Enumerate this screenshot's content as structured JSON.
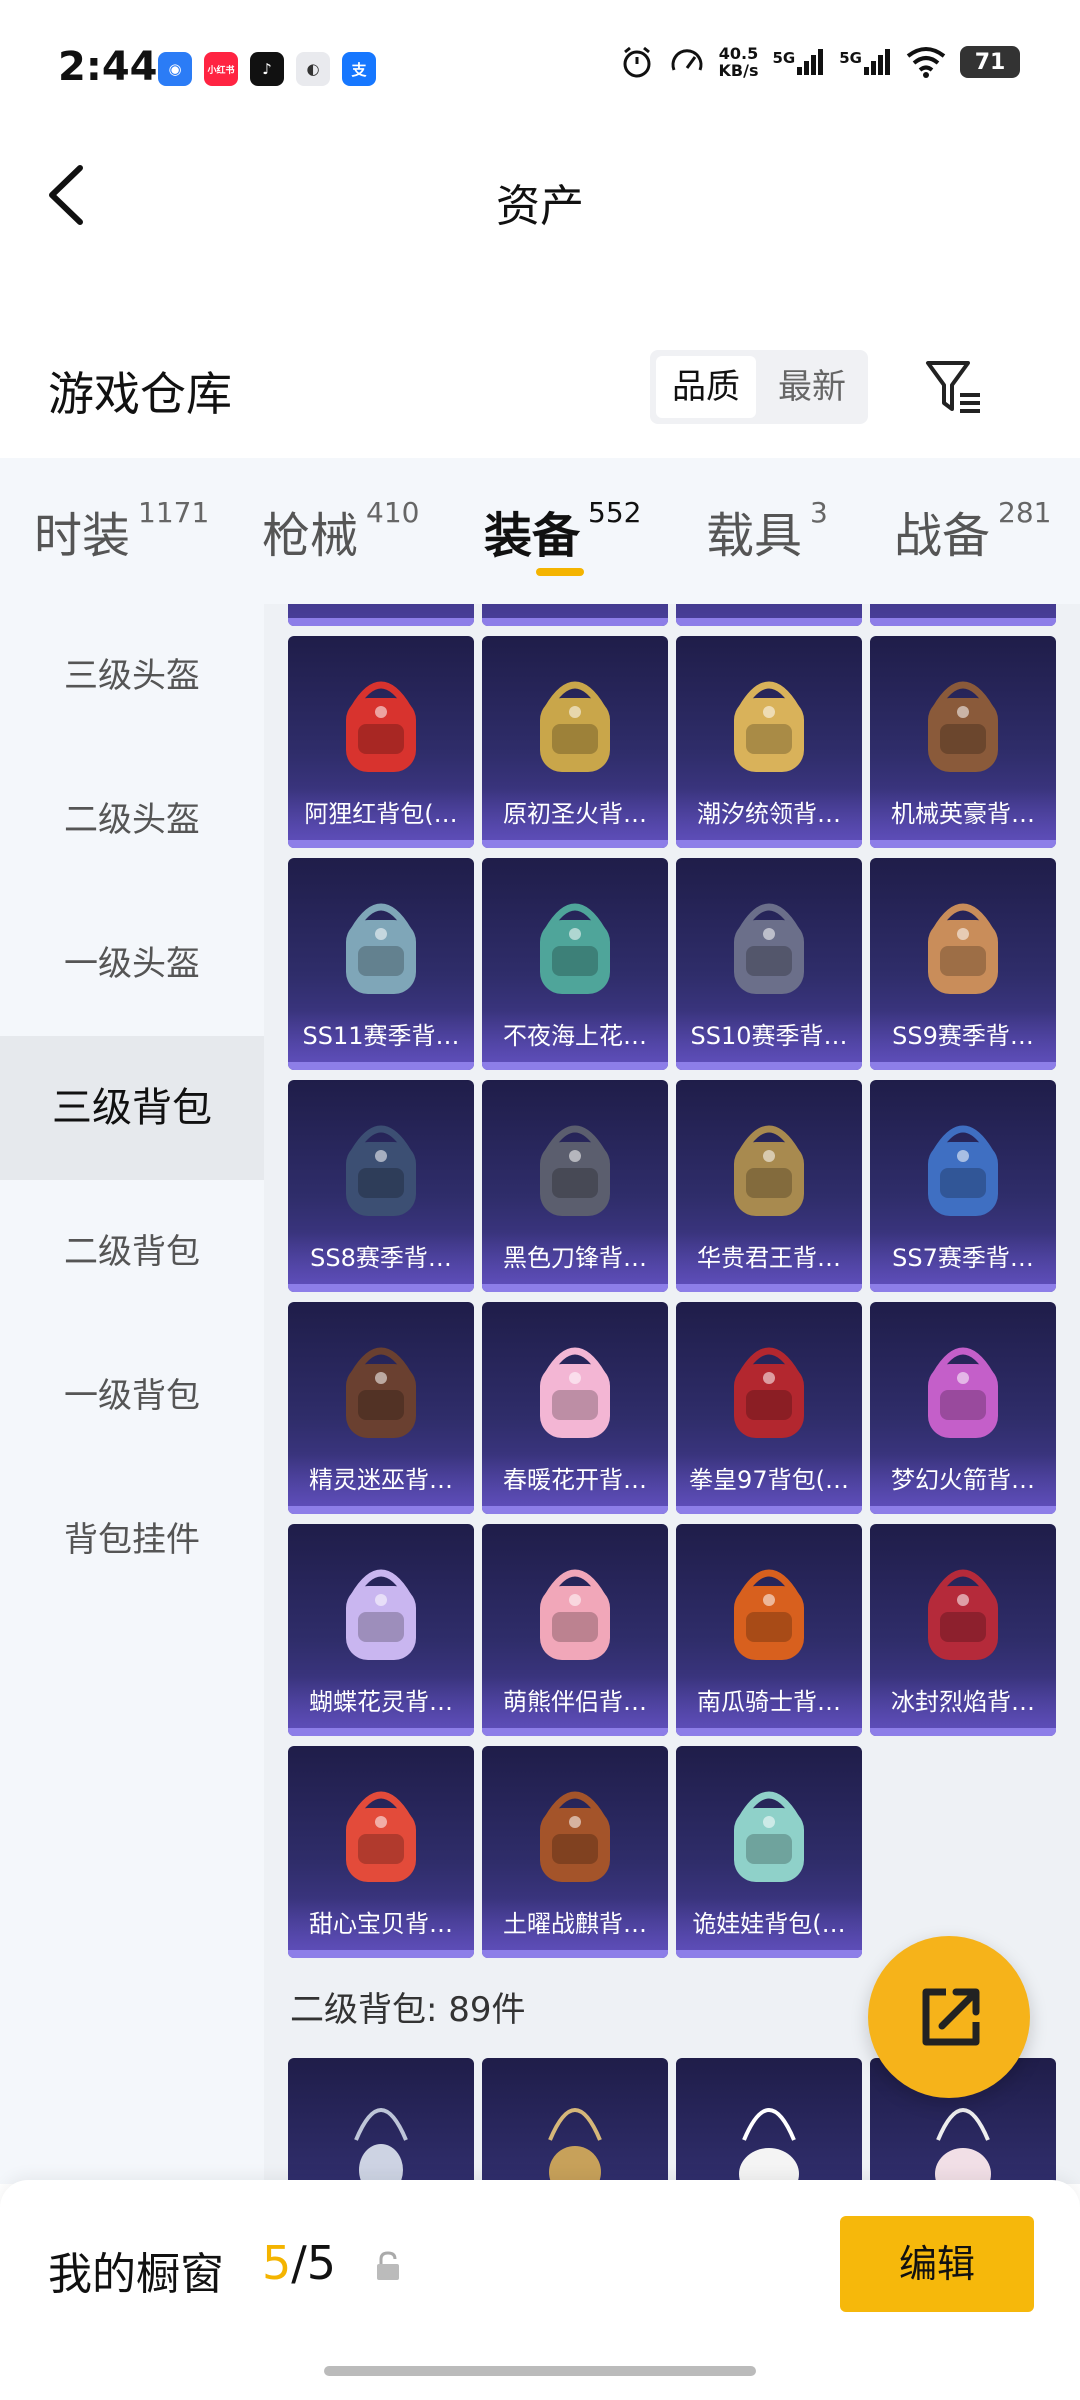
{
  "status": {
    "time": "2:44",
    "net_speed": "40.5\nKB/s",
    "sig1": "5G",
    "sig2": "5G",
    "battery": "71",
    "notif_icons": [
      {
        "name": "blue-app-icon",
        "color": "#2b7cf6",
        "glyph": "◉"
      },
      {
        "name": "xiaohongshu-icon",
        "color": "#ff2442",
        "glyph": "小红书"
      },
      {
        "name": "douyin-icon",
        "color": "#111111",
        "glyph": "♪"
      },
      {
        "name": "link-app-icon",
        "color": "#e9eaee",
        "glyph": "◐"
      },
      {
        "name": "alipay-icon",
        "color": "#1677ff",
        "glyph": "支"
      }
    ]
  },
  "header": {
    "title": "资产"
  },
  "warehouse": {
    "title": "游戏仓库",
    "sort": {
      "active": "品质",
      "other": "最新"
    }
  },
  "tabs": [
    {
      "label": "时装",
      "count": "1171",
      "active": false
    },
    {
      "label": "枪械",
      "count": "410",
      "active": false
    },
    {
      "label": "装备",
      "count": "552",
      "active": true
    },
    {
      "label": "载具",
      "count": "3",
      "active": false
    },
    {
      "label": "战备",
      "count": "281",
      "active": false
    }
  ],
  "sidebar": [
    {
      "label": "三级头盔",
      "active": false
    },
    {
      "label": "二级头盔",
      "active": false
    },
    {
      "label": "一级头盔",
      "active": false
    },
    {
      "label": "三级背包",
      "active": true
    },
    {
      "label": "二级背包",
      "active": false
    },
    {
      "label": "一级背包",
      "active": false
    },
    {
      "label": "背包挂件",
      "active": false
    }
  ],
  "items": [
    {
      "name": "阿狸红背包(…",
      "color": "#d8332e"
    },
    {
      "name": "原初圣火背…",
      "color": "#c9a64a"
    },
    {
      "name": "潮汐统领背…",
      "color": "#d9b25a"
    },
    {
      "name": "机械英豪背…",
      "color": "#8a5a3a"
    },
    {
      "name": "SS11赛季背…",
      "color": "#7fa6b8"
    },
    {
      "name": "不夜海上花…",
      "color": "#4fa59a"
    },
    {
      "name": "SS10赛季背…",
      "color": "#6b6f8a"
    },
    {
      "name": "SS9赛季背…",
      "color": "#c98d5a"
    },
    {
      "name": "SS8赛季背…",
      "color": "#3c4f73"
    },
    {
      "name": "黑色刀锋背…",
      "color": "#5b5e6e"
    },
    {
      "name": "华贵君王背…",
      "color": "#a88a4f"
    },
    {
      "name": "SS7赛季背…",
      "color": "#3f6fc2"
    },
    {
      "name": "精灵迷巫背…",
      "color": "#6a4030"
    },
    {
      "name": "春暖花开背…",
      "color": "#f3b6d4"
    },
    {
      "name": "拳皇97背包(…",
      "color": "#b3272f"
    },
    {
      "name": "梦幻火箭背…",
      "color": "#c45fc9"
    },
    {
      "name": "蝴蝶花灵背…",
      "color": "#c9b6f0"
    },
    {
      "name": "萌熊伴侣背…",
      "color": "#f1a7b9"
    },
    {
      "name": "南瓜骑士背…",
      "color": "#d8601e"
    },
    {
      "name": "冰封烈焰背…",
      "color": "#b52a3a"
    },
    {
      "name": "甜心宝贝背…",
      "color": "#e34b3a"
    },
    {
      "name": "土曜战麒背…",
      "color": "#a4542a"
    },
    {
      "name": "诡娃娃背包(…",
      "color": "#8fd1c9"
    }
  ],
  "section2": {
    "title": "二级背包: 89件"
  },
  "bottom": {
    "label": "我的橱窗",
    "used": "5",
    "total": "/5",
    "edit": "编辑"
  }
}
